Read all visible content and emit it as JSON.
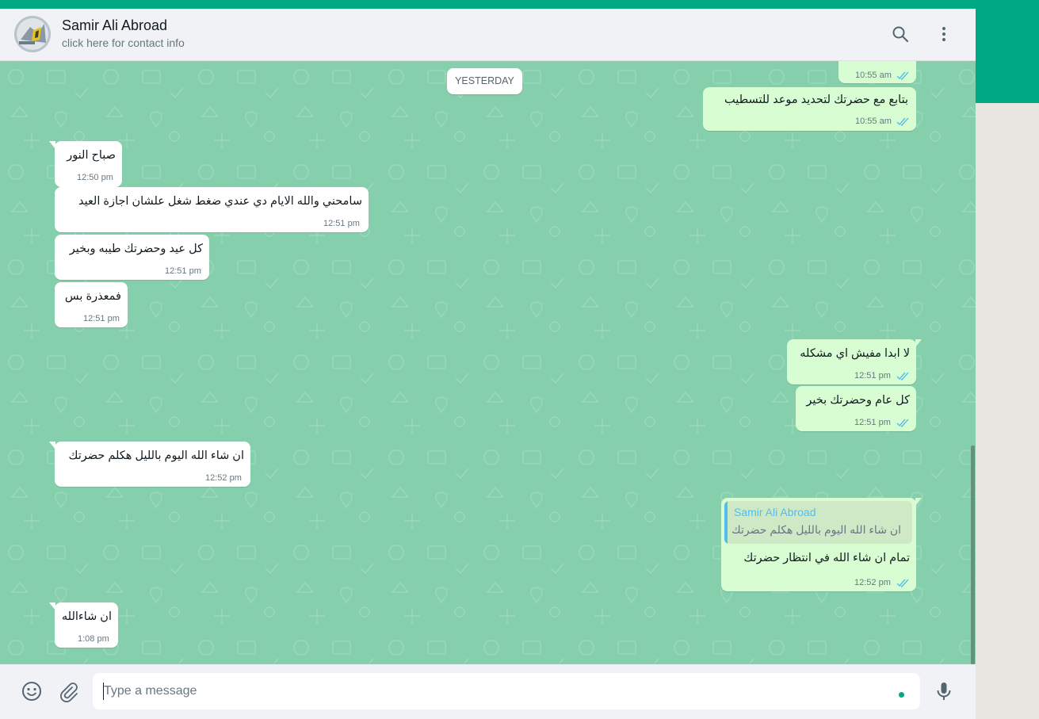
{
  "header": {
    "contact_name": "Samir Ali Abroad",
    "contact_sub": "click here for contact info",
    "search_icon": "search-icon",
    "menu_icon": "kebab-menu-icon"
  },
  "chat": {
    "date_separator": "YESTERDAY",
    "messages": [
      {
        "dir": "out",
        "text": "",
        "time": "10:55 am",
        "status": "read"
      },
      {
        "dir": "out",
        "text": "بتابع مع حضرتك لتحديد موعد للتسطيب",
        "time": "10:55 am",
        "status": "read"
      },
      {
        "dir": "in",
        "text": "صباح النور",
        "time": "12:50 pm"
      },
      {
        "dir": "in",
        "text": "سامحني والله الايام دي عندي ضغط شغل علشان اجازة العيد",
        "time": "12:51 pm"
      },
      {
        "dir": "in",
        "text": "كل عيد وحضرتك طيبه وبخير",
        "time": "12:51 pm"
      },
      {
        "dir": "in",
        "text": "فمعذرة بس",
        "time": "12:51 pm"
      },
      {
        "dir": "out",
        "text": "لا ابدا مفيش اي مشكله",
        "time": "12:51 pm",
        "status": "read"
      },
      {
        "dir": "out",
        "text": "كل عام وحضرتك بخير",
        "time": "12:51 pm",
        "status": "read"
      },
      {
        "dir": "in",
        "text": "ان شاء الله اليوم بالليل هكلم حضرتك",
        "time": "12:52 pm"
      },
      {
        "dir": "out",
        "text": "تمام ان شاء الله في انتظار حضرتك",
        "time": "12:52 pm",
        "status": "read",
        "quote": {
          "name": "Samir Ali Abroad",
          "text": "ان شاء الله اليوم بالليل هكلم حضرتك"
        }
      },
      {
        "dir": "in",
        "text": "ان شاءالله",
        "time": "1:08 pm"
      }
    ]
  },
  "footer": {
    "placeholder": "Type a message",
    "emoji_icon": "emoji-icon",
    "attach_icon": "paperclip-icon",
    "mic_icon": "microphone-icon"
  },
  "colors": {
    "accent": "#00a884",
    "chat_bg": "#86cfac",
    "outgoing_bubble": "#d9fdd3",
    "incoming_bubble": "#ffffff",
    "read_ticks": "#53bdeb"
  }
}
